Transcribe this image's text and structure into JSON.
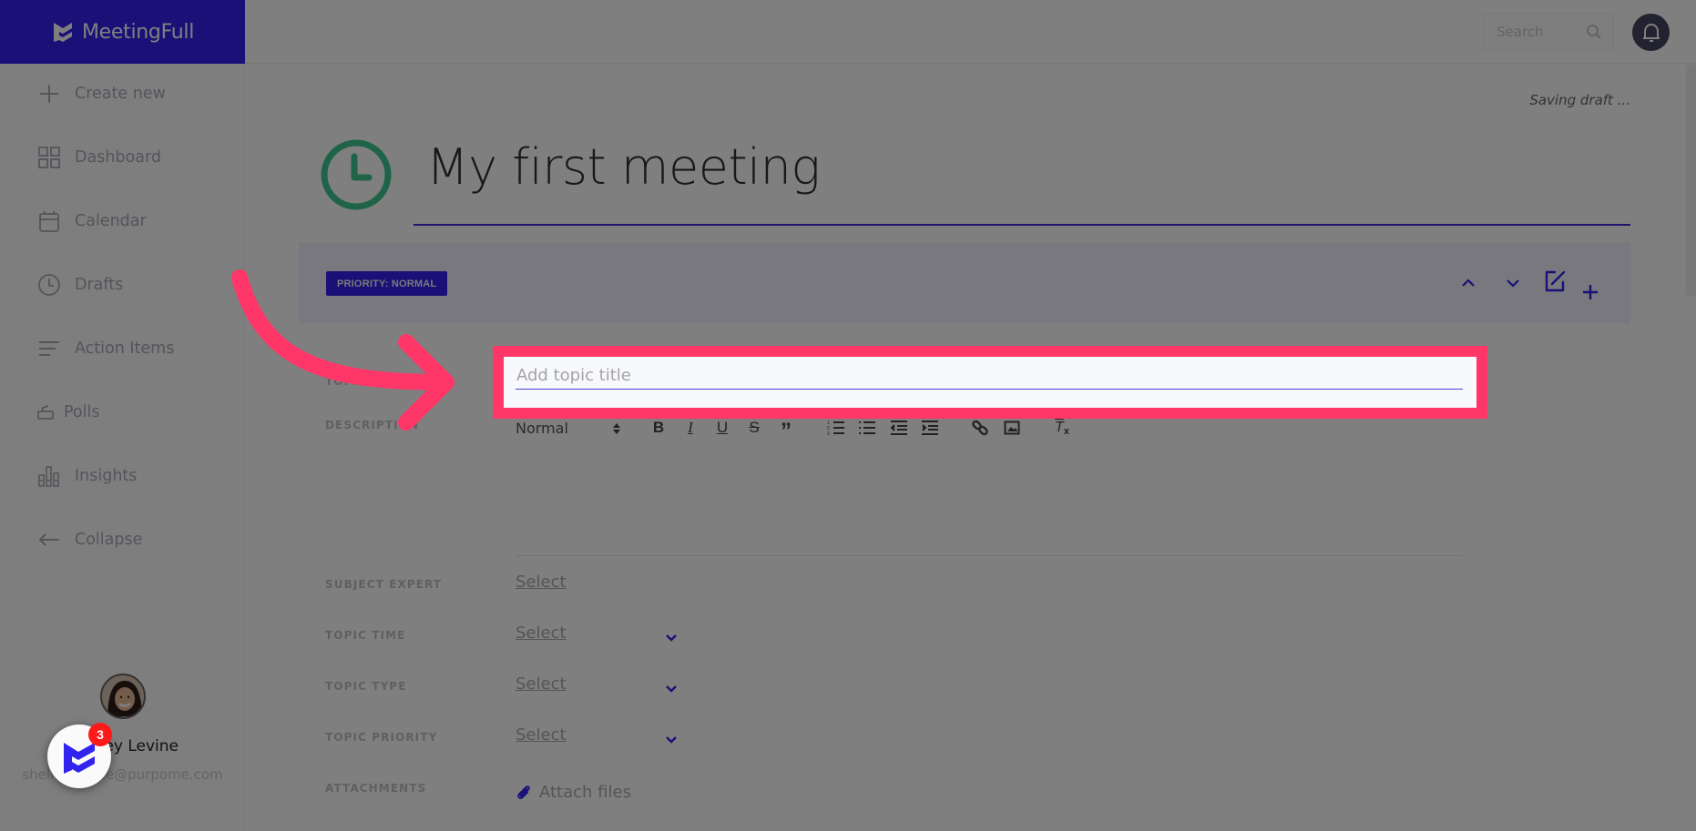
{
  "app": {
    "brand": "MeetingFull",
    "brand_color": "#3323ef",
    "accent_color": "#3a2cd8",
    "highlight_color": "#ff3768"
  },
  "sidebar": {
    "items": [
      {
        "label": "Create new",
        "icon": "plus-icon"
      },
      {
        "label": "Dashboard",
        "icon": "grid-icon"
      },
      {
        "label": "Calendar",
        "icon": "calendar-icon"
      },
      {
        "label": "Drafts",
        "icon": "clock-icon"
      },
      {
        "label": "Action Items",
        "icon": "list-icon"
      },
      {
        "label": "Polls",
        "icon": "poll-box-icon"
      },
      {
        "label": "Insights",
        "icon": "bar-chart-icon"
      },
      {
        "label": "Collapse",
        "icon": "arrow-left-icon"
      }
    ],
    "user": {
      "name": "Shelley Levine",
      "email": "shelley.levine@purpome.com"
    },
    "fab": {
      "badge_count": "3"
    }
  },
  "header": {
    "search_placeholder": "Search"
  },
  "main": {
    "status": "Saving draft ...",
    "meeting_title": "My first meeting",
    "topic": {
      "priority_badge": "PRIORITY: NORMAL",
      "title_label": "TOPIC",
      "title_placeholder": "Add topic title",
      "title_value": "",
      "description_label": "DESCRIPTION",
      "editor": {
        "format_select": "Normal",
        "buttons": [
          "bold",
          "italic",
          "underline",
          "strikethrough",
          "blockquote",
          "ordered-list",
          "bullet-list",
          "outdent",
          "indent",
          "link",
          "image",
          "clear-format"
        ]
      },
      "fields": [
        {
          "label": "SUBJECT EXPERT",
          "value": "Select",
          "dropdown": false
        },
        {
          "label": "TOPIC TIME",
          "value": "Select",
          "dropdown": true
        },
        {
          "label": "TOPIC TYPE",
          "value": "Select",
          "dropdown": true
        },
        {
          "label": "TOPIC PRIORITY",
          "value": "Select",
          "dropdown": true
        }
      ],
      "attachments_label": "ATTACHMENTS",
      "attach_label": "Attach files"
    }
  }
}
